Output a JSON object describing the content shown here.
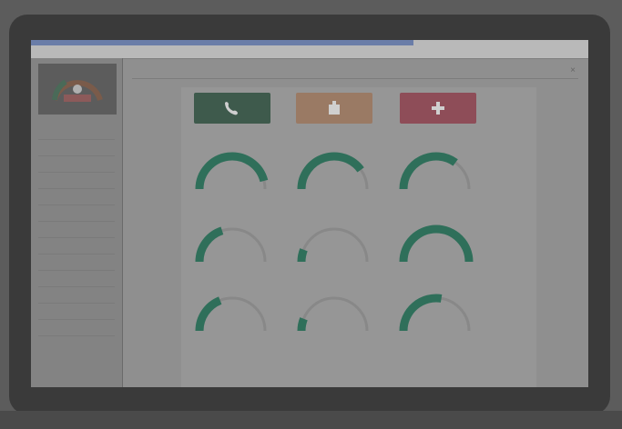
{
  "app": {
    "title": ""
  },
  "colors": {
    "kpi_phone": "#3e5a4c",
    "kpi_orange": "#9a7a64",
    "kpi_red": "#8e4d58",
    "gauge_fill": "#2f6f5a",
    "gauge_track": "#888888"
  },
  "sidebar": {
    "items": [
      "",
      "",
      "",
      "",
      "",
      "",
      "",
      "",
      "",
      "",
      "",
      "",
      ""
    ]
  },
  "kpis": [
    {
      "icon": "phone-icon",
      "label": ""
    },
    {
      "icon": "box-icon",
      "label": ""
    },
    {
      "icon": "cross-icon",
      "label": ""
    }
  ],
  "gauges": [
    {
      "value_text": "",
      "label": "",
      "fraction": 0.92
    },
    {
      "value_text": "",
      "label": "",
      "fraction": 0.8
    },
    {
      "value_text": "",
      "label": "",
      "fraction": 0.7
    },
    {
      "value_text": "",
      "label": "",
      "fraction": 0.4
    },
    {
      "value_text": "",
      "label": "",
      "fraction": 0.12
    },
    {
      "value_text": "",
      "label": "",
      "fraction": 1.0
    },
    {
      "value_text": "",
      "label": "",
      "fraction": 0.38
    },
    {
      "value_text": "",
      "label": "",
      "fraction": 0.12
    },
    {
      "value_text": "",
      "label": "",
      "fraction": 0.55
    }
  ]
}
